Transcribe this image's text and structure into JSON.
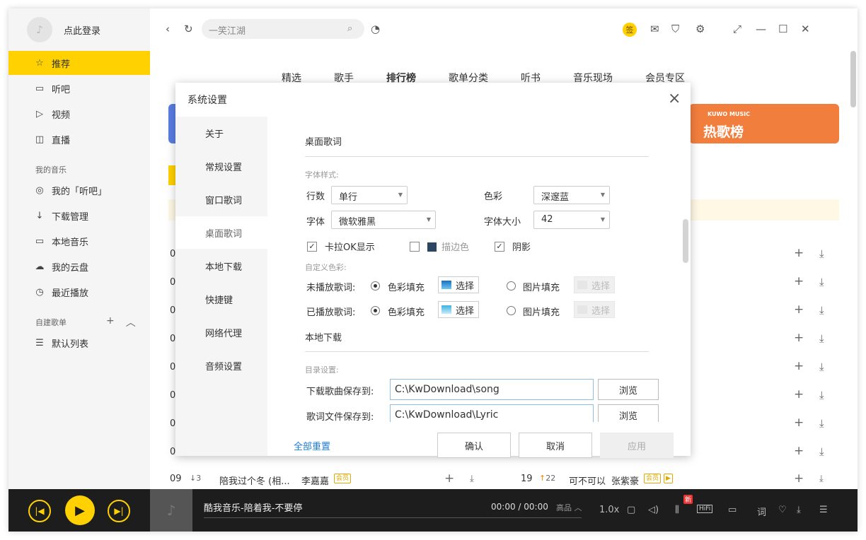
{
  "sidebar": {
    "login_label": "点此登录",
    "main_items": [
      {
        "label": "推荐",
        "icon": "star-icon"
      },
      {
        "label": "听吧",
        "icon": "radio-icon"
      },
      {
        "label": "视频",
        "icon": "video-icon"
      },
      {
        "label": "直播",
        "icon": "live-camera-icon"
      }
    ],
    "my_music_title": "我的音乐",
    "my_items": [
      {
        "label": "我的「听吧」",
        "icon": "location-icon"
      },
      {
        "label": "下载管理",
        "icon": "download-icon"
      },
      {
        "label": "本地音乐",
        "icon": "monitor-icon"
      },
      {
        "label": "我的云盘",
        "icon": "cloud-icon"
      },
      {
        "label": "最近播放",
        "icon": "clock-icon"
      }
    ],
    "playlist_title": "自建歌单",
    "playlist_items": [
      {
        "label": "默认列表",
        "icon": "list-icon"
      }
    ]
  },
  "topbar": {
    "search_placeholder": "一笑江湖",
    "vip_badge": "签"
  },
  "tabs": [
    {
      "label": "精选",
      "active": false
    },
    {
      "label": "歌手",
      "active": false
    },
    {
      "label": "排行榜",
      "active": true
    },
    {
      "label": "歌单分类",
      "active": false
    },
    {
      "label": "听书",
      "active": false
    },
    {
      "label": "音乐现场",
      "active": false
    },
    {
      "label": "会员专区",
      "active": false
    }
  ],
  "banner": {
    "brand": "KUWO MUSIC",
    "title": "热歌榜"
  },
  "list": {
    "row_prefix": "0",
    "row9": {
      "rank": "09",
      "change": "3",
      "title": "陪我过个冬 (相...",
      "artist": "李嘉嘉",
      "tag": "会员"
    },
    "row19": {
      "rank": "19",
      "change": "22",
      "title": "可不可以",
      "artist": "张紫豪",
      "tag": "会员"
    }
  },
  "player": {
    "song": "酷我音乐-陪着我-不要停",
    "time": "00:00 / 00:00",
    "quality": "高品",
    "speed": "1.0x",
    "new_tag": "新",
    "hifi": "HiFi",
    "lyric_btn": "词"
  },
  "dialog": {
    "title": "系统设置",
    "nav": [
      "关于",
      "常规设置",
      "窗口歌词",
      "桌面歌词",
      "本地下载",
      "快捷键",
      "网络代理",
      "音频设置"
    ],
    "active_nav": "桌面歌词",
    "desktop_lyrics": {
      "section_title": "桌面歌词",
      "font_style_label": "字体样式:",
      "rows_label": "行数",
      "rows_value": "单行",
      "color_label": "色彩",
      "color_value": "深邃蓝",
      "font_label": "字体",
      "font_value": "微软雅黑",
      "font_size_label": "字体大小",
      "font_size_value": "42",
      "karaoke_label": "卡拉OK显示",
      "karaoke_checked": true,
      "stroke_label": "描边色",
      "stroke_checked": false,
      "shadow_label": "阴影",
      "shadow_checked": true,
      "custom_color_label": "自定义色彩:",
      "unplayed_label": "未播放歌词:",
      "played_label": "已播放歌词:",
      "color_fill_label": "色彩填充",
      "image_fill_label": "图片填充",
      "choose_label": "选择"
    },
    "local_download": {
      "section_title": "本地下载",
      "dir_label": "目录设置:",
      "song_dir_label": "下载歌曲保存到:",
      "song_dir_value": "C:\\KwDownload\\song",
      "lyric_dir_label": "歌词文件保存到:",
      "lyric_dir_value": "C:\\KwDownload\\Lyric",
      "browse_label": "浏览"
    },
    "footer": {
      "reset": "全部重置",
      "confirm": "确认",
      "cancel": "取消",
      "apply": "应用"
    }
  },
  "colors": {
    "accent": "#ffd100",
    "banner": "#f27e3e",
    "player_bg": "#1d1d1d",
    "link": "#1c7cd6"
  }
}
